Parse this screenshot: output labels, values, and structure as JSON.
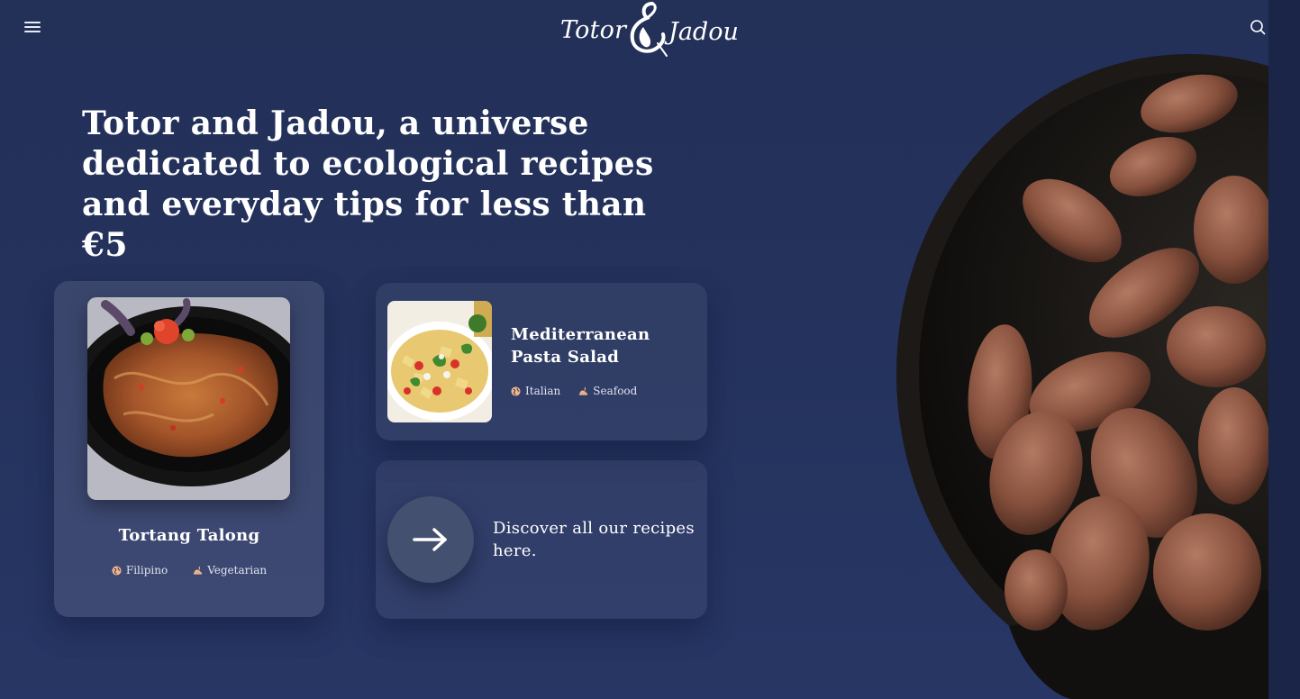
{
  "header": {
    "menu_icon": "hamburger-menu-icon",
    "logo_left": "Totor",
    "logo_right": "Jadou",
    "search_icon": "search-icon"
  },
  "hero": {
    "title": "Totor and Jadou, a universe dedicated to ecological recipes and everyday tips for less than €5"
  },
  "recipes": [
    {
      "title": "Tortang Talong",
      "cuisine": "Filipino",
      "category": "Vegetarian"
    },
    {
      "title": "Mediterranean Pasta Salad",
      "cuisine": "Italian",
      "category": "Seafood"
    }
  ],
  "discover": {
    "text": "Discover all our recipes here.",
    "icon": "arrow-right-icon"
  },
  "colors": {
    "background": "#24325d",
    "accent_tag": "#f0b48a"
  }
}
